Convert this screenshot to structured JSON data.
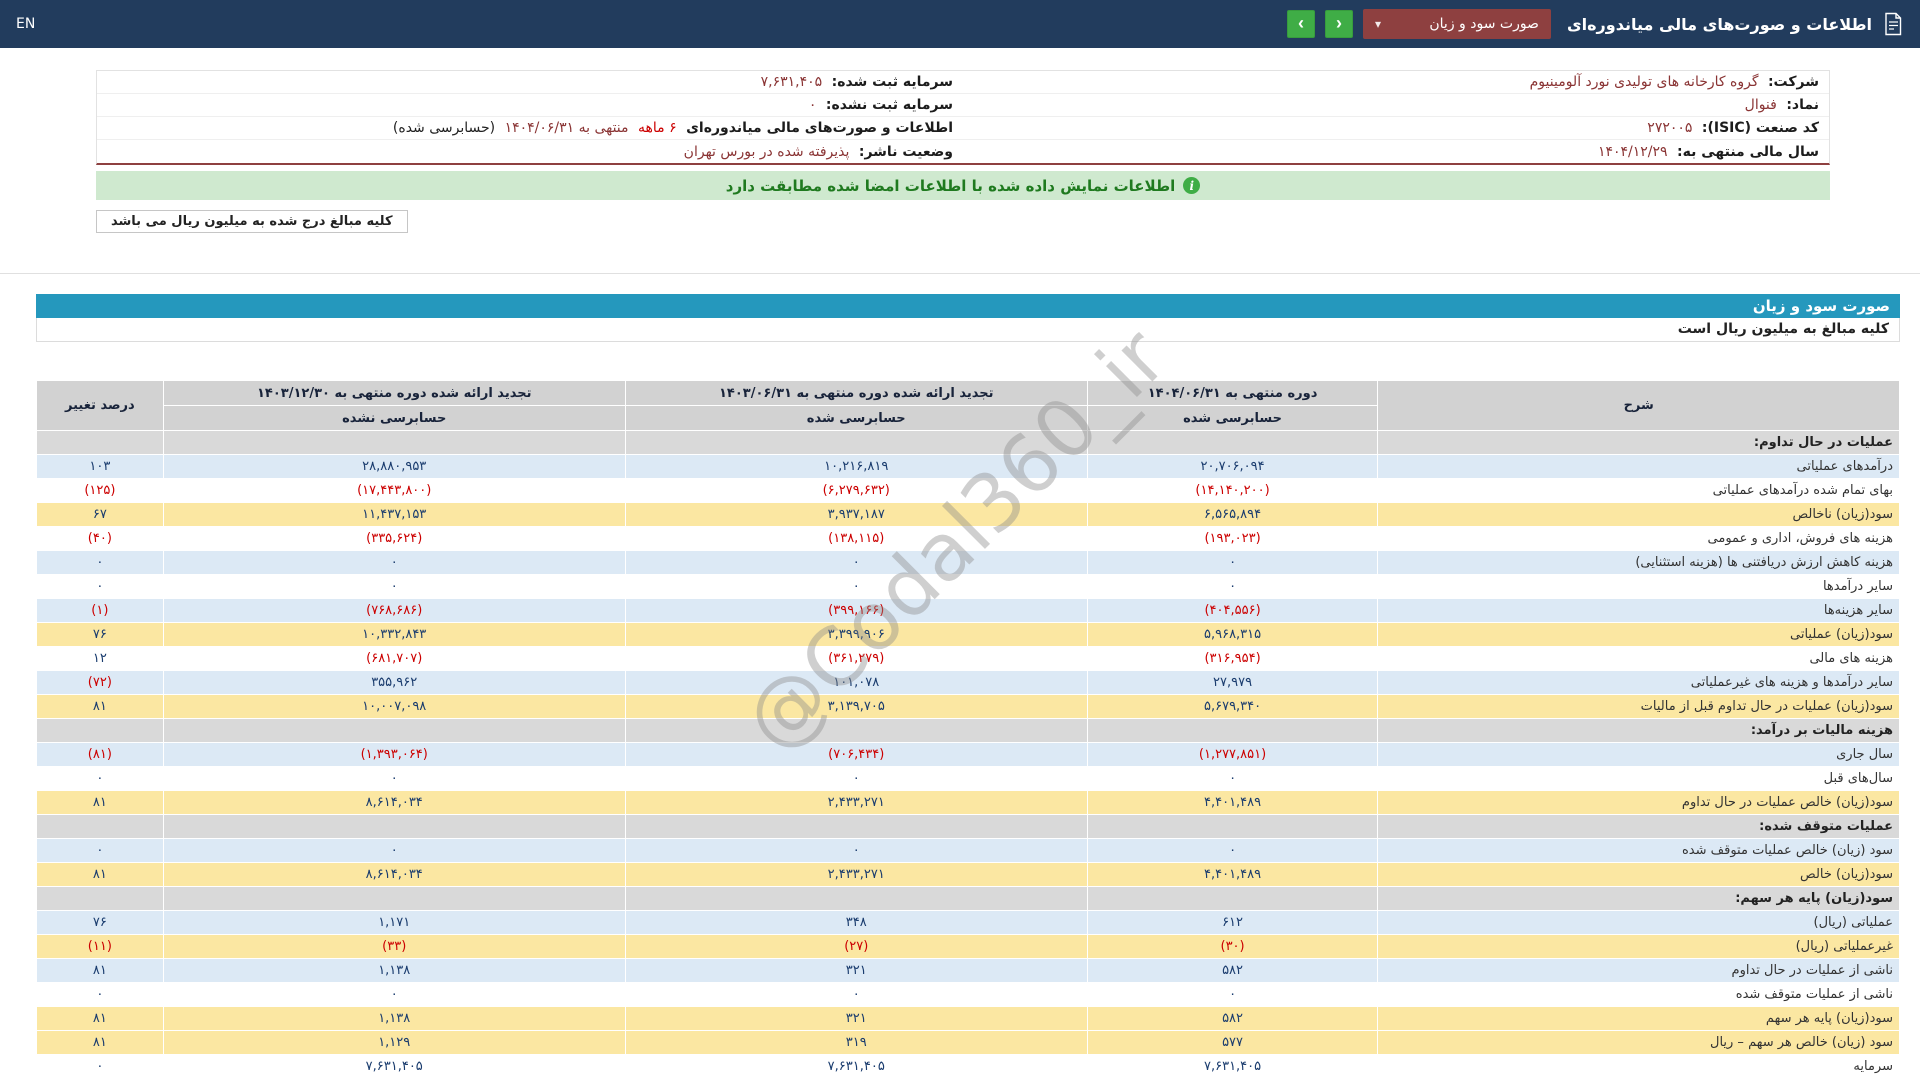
{
  "navbar": {
    "title": "اطلاعات و صورت‌های مالی میاندوره‌ای",
    "dropdown_value": "صورت سود و زیان",
    "caret_icon": "▾",
    "prev_icon": "‹",
    "next_icon": "›",
    "lang": "EN"
  },
  "company_info": {
    "rows": [
      {
        "r_label": "شرکت:",
        "r_value": "گروه کارخانه های تولیدی نورد آلومینیوم",
        "l_label": "سرمایه ثبت شده:",
        "l_value": "۷,۶۳۱,۴۰۵"
      },
      {
        "r_label": "نماد:",
        "r_value": "فنوال",
        "l_label": "سرمایه ثبت نشده:",
        "l_value": "۰"
      },
      {
        "r_label": "کد صنعت (ISIC):",
        "r_value": "۲۷۲۰۰۵",
        "l_label": "اطلاعات و صورت‌های مالی میاندوره‌ای",
        "l_red": "۶ ماهه",
        "l_rest": "منتهی به ۱۴۰۴/۰۶/۳۱",
        "l_suffix": "(حسابرسی شده)"
      },
      {
        "r_label": "سال مالی منتهی به:",
        "r_value": "۱۴۰۴/۱۲/۲۹",
        "l_label": "وضعیت ناشر:",
        "l_value": "پذیرفته شده در بورس تهران"
      }
    ]
  },
  "banner": {
    "text": "اطلاعات نمایش داده شده با اطلاعات امضا شده مطابقت دارد",
    "icon": "i"
  },
  "million_note": "کلیه مبالغ درج شده به میلیون ریال می باشد",
  "watermark": "@Codal360_ir",
  "statement": {
    "title": "صورت سود و زیان",
    "unit_note": "کلیه مبالغ به میلیون ریال است",
    "columns": {
      "desc": "شرح",
      "col1_title": "دوره منتهی به ۱۴۰۴/۰۶/۳۱",
      "col1_sub": "حسابرسی شده",
      "col2_title": "تجدید ارائه شده دوره منتهی به ۱۴۰۳/۰۶/۳۱",
      "col2_sub": "حسابرسی شده",
      "col3_title": "تجدید ارائه شده دوره منتهی به ۱۴۰۳/۱۲/۳۰",
      "col3_sub": "حسابرسی نشده",
      "pct": "درصد تغییر"
    },
    "rows": [
      {
        "style": "section",
        "label": "عملیات در حال تداوم:"
      },
      {
        "style": "alt",
        "label": "درآمدهای عملیاتی",
        "values": [
          "۲۰,۷۰۶,۰۹۴",
          "۱۰,۲۱۶,۸۱۹",
          "۲۸,۸۸۰,۹۵۳",
          "۱۰۳"
        ]
      },
      {
        "style": "plain",
        "label": "بهای تمام شده درآمدهای عملیاتی",
        "values": [
          "(۱۴,۱۴۰,۲۰۰)",
          "(۶,۲۷۹,۶۳۲)",
          "(۱۷,۴۴۳,۸۰۰)",
          "(۱۲۵)"
        ]
      },
      {
        "style": "total",
        "label": "سود(زیان) ناخالص",
        "values": [
          "۶,۵۶۵,۸۹۴",
          "۳,۹۳۷,۱۸۷",
          "۱۱,۴۳۷,۱۵۳",
          "۶۷"
        ]
      },
      {
        "style": "plain",
        "label": "هزینه های فروش، اداری و عمومی",
        "values": [
          "(۱۹۳,۰۲۳)",
          "(۱۳۸,۱۱۵)",
          "(۳۳۵,۶۲۴)",
          "(۴۰)"
        ]
      },
      {
        "style": "alt",
        "label": "هزینه کاهش ارزش دریافتنی ها (هزینه استثنایی)",
        "values": [
          "۰",
          "۰",
          "۰",
          "۰"
        ]
      },
      {
        "style": "plain",
        "label": "سایر درآمدها",
        "values": [
          "۰",
          "۰",
          "۰",
          "۰"
        ]
      },
      {
        "style": "alt",
        "label": "سایر هزینه‌ها",
        "values": [
          "(۴۰۴,۵۵۶)",
          "(۳۹۹,۱۶۶)",
          "(۷۶۸,۶۸۶)",
          "(۱)"
        ]
      },
      {
        "style": "total",
        "label": "سود(زیان) عملیاتی",
        "values": [
          "۵,۹۶۸,۳۱۵",
          "۳,۳۹۹,۹۰۶",
          "۱۰,۳۳۲,۸۴۳",
          "۷۶"
        ]
      },
      {
        "style": "plain",
        "label": "هزینه های مالی",
        "values": [
          "(۳۱۶,۹۵۴)",
          "(۳۶۱,۲۷۹)",
          "(۶۸۱,۷۰۷)",
          "۱۲"
        ]
      },
      {
        "style": "alt",
        "label": "سایر درآمدها و هزینه های غیرعملیاتی",
        "values": [
          "۲۷,۹۷۹",
          "۱۰۱,۰۷۸",
          "۳۵۵,۹۶۲",
          "(۷۲)"
        ]
      },
      {
        "style": "total",
        "label": "سود(زیان) عملیات در حال تداوم قبل از مالیات",
        "values": [
          "۵,۶۷۹,۳۴۰",
          "۳,۱۳۹,۷۰۵",
          "۱۰,۰۰۷,۰۹۸",
          "۸۱"
        ]
      },
      {
        "style": "section",
        "label": "هزینه مالیات بر درآمد:"
      },
      {
        "style": "alt",
        "label": "سال جاری",
        "values": [
          "(۱,۲۷۷,۸۵۱)",
          "(۷۰۶,۴۳۴)",
          "(۱,۳۹۳,۰۶۴)",
          "(۸۱)"
        ]
      },
      {
        "style": "plain",
        "label": "سال‌های قبل",
        "values": [
          "۰",
          "۰",
          "۰",
          "۰"
        ]
      },
      {
        "style": "total",
        "label": "سود(زیان) خالص عملیات در حال تداوم",
        "values": [
          "۴,۴۰۱,۴۸۹",
          "۲,۴۳۳,۲۷۱",
          "۸,۶۱۴,۰۳۴",
          "۸۱"
        ]
      },
      {
        "style": "section",
        "label": "عملیات متوقف شده:"
      },
      {
        "style": "alt",
        "label": "سود (زیان) خالص عملیات متوقف شده",
        "values": [
          "۰",
          "۰",
          "۰",
          "۰"
        ]
      },
      {
        "style": "total",
        "label": "سود(زیان) خالص",
        "values": [
          "۴,۴۰۱,۴۸۹",
          "۲,۴۳۳,۲۷۱",
          "۸,۶۱۴,۰۳۴",
          "۸۱"
        ]
      },
      {
        "style": "section",
        "label": "سود(زیان) پایه هر سهم:"
      },
      {
        "style": "alt",
        "label": "عملیاتی (ریال)",
        "values": [
          "۶۱۲",
          "۳۴۸",
          "۱,۱۷۱",
          "۷۶"
        ]
      },
      {
        "style": "total",
        "label": "غیرعملیاتی (ریال)",
        "values": [
          "(۳۰)",
          "(۲۷)",
          "(۳۳)",
          "(۱۱)"
        ]
      },
      {
        "style": "alt",
        "label": "ناشی از عملیات در حال تداوم",
        "values": [
          "۵۸۲",
          "۳۲۱",
          "۱,۱۳۸",
          "۸۱"
        ]
      },
      {
        "style": "plain",
        "label": "ناشی از عملیات متوقف شده",
        "values": [
          "۰",
          "۰",
          "۰",
          "۰"
        ]
      },
      {
        "style": "total",
        "label": "سود(زیان) پایه هر سهم",
        "values": [
          "۵۸۲",
          "۳۲۱",
          "۱,۱۳۸",
          "۸۱"
        ]
      },
      {
        "style": "total",
        "label": "سود (زیان) خالص هر سهم – ریال",
        "values": [
          "۵۷۷",
          "۳۱۹",
          "۱,۱۲۹",
          "۸۱"
        ]
      },
      {
        "style": "plain",
        "label": "سرمایه",
        "values": [
          "۷,۶۳۱,۴۰۵",
          "۷,۶۳۱,۴۰۵",
          "۷,۶۳۱,۴۰۵",
          "۰"
        ]
      }
    ]
  },
  "colors": {
    "navbar": "#223c5d",
    "accent_green": "#3fad46",
    "dropdown_maroon": "#8e4040",
    "banner_bg": "#cfe9cf",
    "banner_text": "#1f7a1f",
    "statement_bar": "#2598bd",
    "row_alt": "#dce9f5",
    "row_total": "#fbe7a2",
    "row_section": "#d9d9d9",
    "negative": "#cc0000",
    "number": "#1a3c6e",
    "maroon_value": "#8a3434"
  }
}
